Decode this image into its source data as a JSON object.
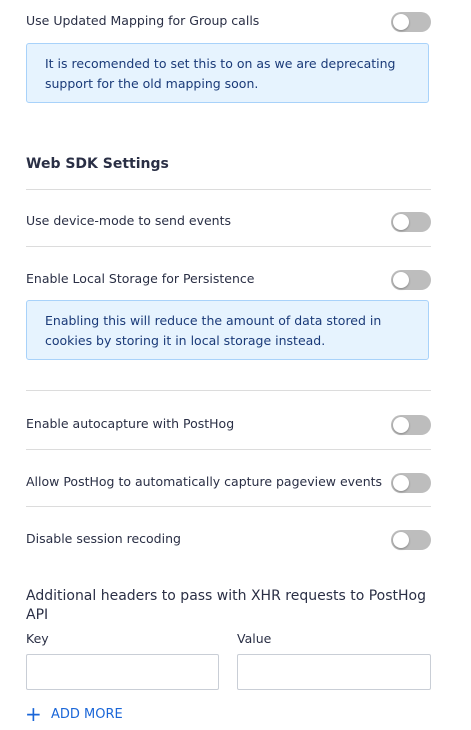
{
  "settings": {
    "group_mapping": {
      "label": "Use Updated Mapping for Group calls",
      "enabled": false,
      "info": "It is recomended to set this to on as we are deprecating support for the old mapping soon."
    },
    "section_title": "Web SDK Settings",
    "device_mode": {
      "label": "Use device-mode to send events",
      "enabled": false
    },
    "local_storage": {
      "label": "Enable Local Storage for Persistence",
      "enabled": false,
      "info": "Enabling this will reduce the amount of data stored in cookies by storing it in local storage instead."
    },
    "autocapture": {
      "label": "Enable autocapture with PostHog",
      "enabled": false
    },
    "pageview": {
      "label": "Allow PostHog to automatically capture pageview events",
      "enabled": false
    },
    "session": {
      "label": "Disable session recoding",
      "enabled": false
    }
  },
  "headers": {
    "title": "Additional headers to pass with XHR requests to PostHog API",
    "key_label": "Key",
    "value_label": "Value",
    "key_value": "",
    "value_value": "",
    "add_more": "ADD MORE"
  },
  "colors": {
    "accent": "#1a66d8",
    "info_bg": "#e6f3fe",
    "toggle_off": "#bdbdbd"
  }
}
